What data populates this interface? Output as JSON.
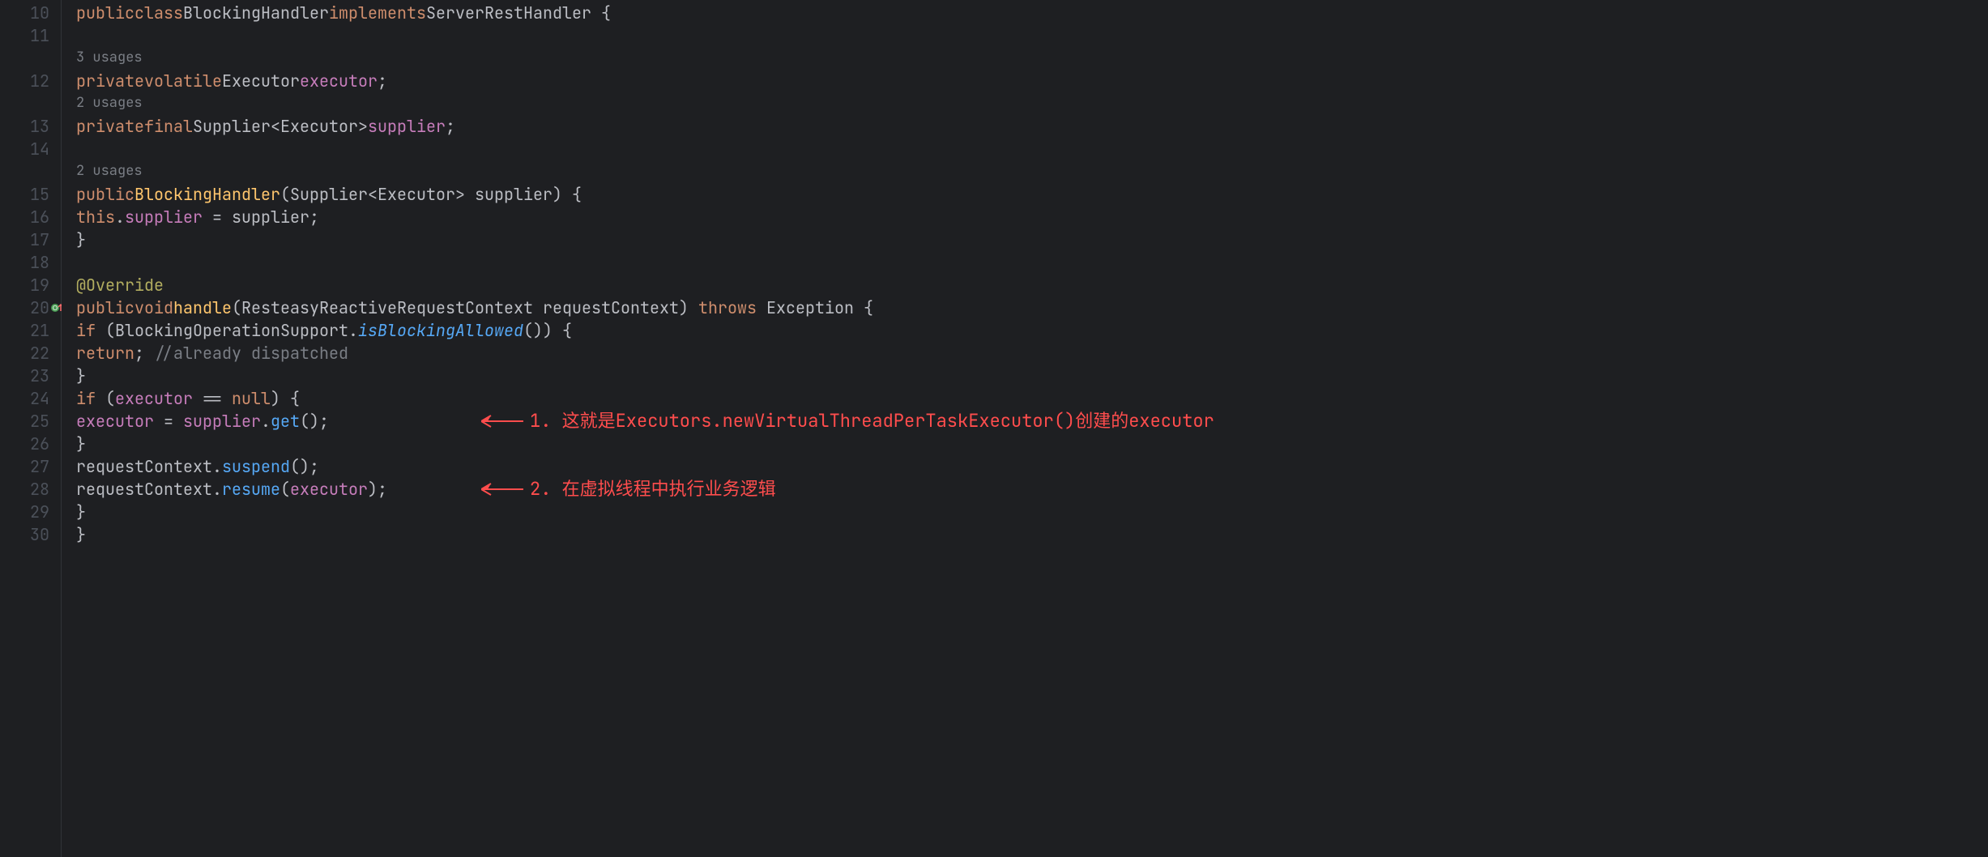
{
  "lines": [
    {
      "num": "10"
    },
    {
      "num": "11"
    },
    {
      "num": "12"
    },
    {
      "num": "13"
    },
    {
      "num": "14"
    },
    {
      "num": "15"
    },
    {
      "num": "16"
    },
    {
      "num": "17"
    },
    {
      "num": "18"
    },
    {
      "num": "19"
    },
    {
      "num": "20"
    },
    {
      "num": "21"
    },
    {
      "num": "22"
    },
    {
      "num": "23"
    },
    {
      "num": "24"
    },
    {
      "num": "25"
    },
    {
      "num": "26"
    },
    {
      "num": "27"
    },
    {
      "num": "28"
    },
    {
      "num": "29"
    },
    {
      "num": "30"
    }
  ],
  "usages": {
    "u1": "3 usages",
    "u2": "2 usages",
    "u3": "2 usages"
  },
  "code": {
    "l10_public": "public",
    "l10_class": "class",
    "l10_name": "BlockingHandler",
    "l10_implements": "implements",
    "l10_iface": "ServerRestHandler",
    "l10_brace": " {",
    "l12_private": "private",
    "l12_volatile": "volatile",
    "l12_type": "Executor",
    "l12_field": "executor",
    "l12_semi": ";",
    "l13_private": "private",
    "l13_final": "final",
    "l13_type": "Supplier",
    "l13_lt": "<",
    "l13_generic": "Executor",
    "l13_gt": ">",
    "l13_field": "supplier",
    "l13_semi": ";",
    "l15_public": "public",
    "l15_ctor": "BlockingHandler",
    "l15_open": "(",
    "l15_ptype": "Supplier",
    "l15_lt": "<",
    "l15_pg": "Executor",
    "l15_gt": ">",
    "l15_pname": " supplier",
    "l15_close": ") {",
    "l16_this": "this",
    "l16_dot": ".",
    "l16_field": "supplier",
    "l16_eq": " = ",
    "l16_param": "supplier",
    "l16_semi": ";",
    "l17_brace": "}",
    "l19_annotation": "@Override",
    "l20_public": "public",
    "l20_void": "void",
    "l20_method": "handle",
    "l20_open": "(",
    "l20_ptype": "ResteasyReactiveRequestContext",
    "l20_pname": " requestContext",
    "l20_close": ") ",
    "l20_throws": "throws",
    "l20_exc": " Exception {",
    "l21_if": "if",
    "l21_open": " (",
    "l21_cls": "BlockingOperationSupport",
    "l21_dot": ".",
    "l21_method": "isBlockingAllowed",
    "l21_call": "()",
    "l21_close": ") {",
    "l22_return": "return",
    "l22_semi": "; ",
    "l22_comment": "//already dispatched",
    "l23_brace": "}",
    "l24_if": "if",
    "l24_open": " (",
    "l24_field": "executor",
    "l24_eq": " == ",
    "l24_null": "null",
    "l24_close": ") {",
    "l25_field": "executor",
    "l25_eq": " = ",
    "l25_supplier": "supplier",
    "l25_dot": ".",
    "l25_get": "get",
    "l25_call": "();",
    "l26_brace": "}",
    "l27_ctx": "requestContext",
    "l27_dot": ".",
    "l27_method": "suspend",
    "l27_call": "();",
    "l28_ctx": "requestContext",
    "l28_dot": ".",
    "l28_method": "resume",
    "l28_open": "(",
    "l28_field": "executor",
    "l28_close": ");",
    "l29_brace": "}",
    "l30_brace": "}"
  },
  "annotations": {
    "a1": "1. 这就是Executors.newVirtualThreadPerTaskExecutor()创建的executor",
    "a2": "2. 在虚拟线程中执行业务逻辑"
  }
}
